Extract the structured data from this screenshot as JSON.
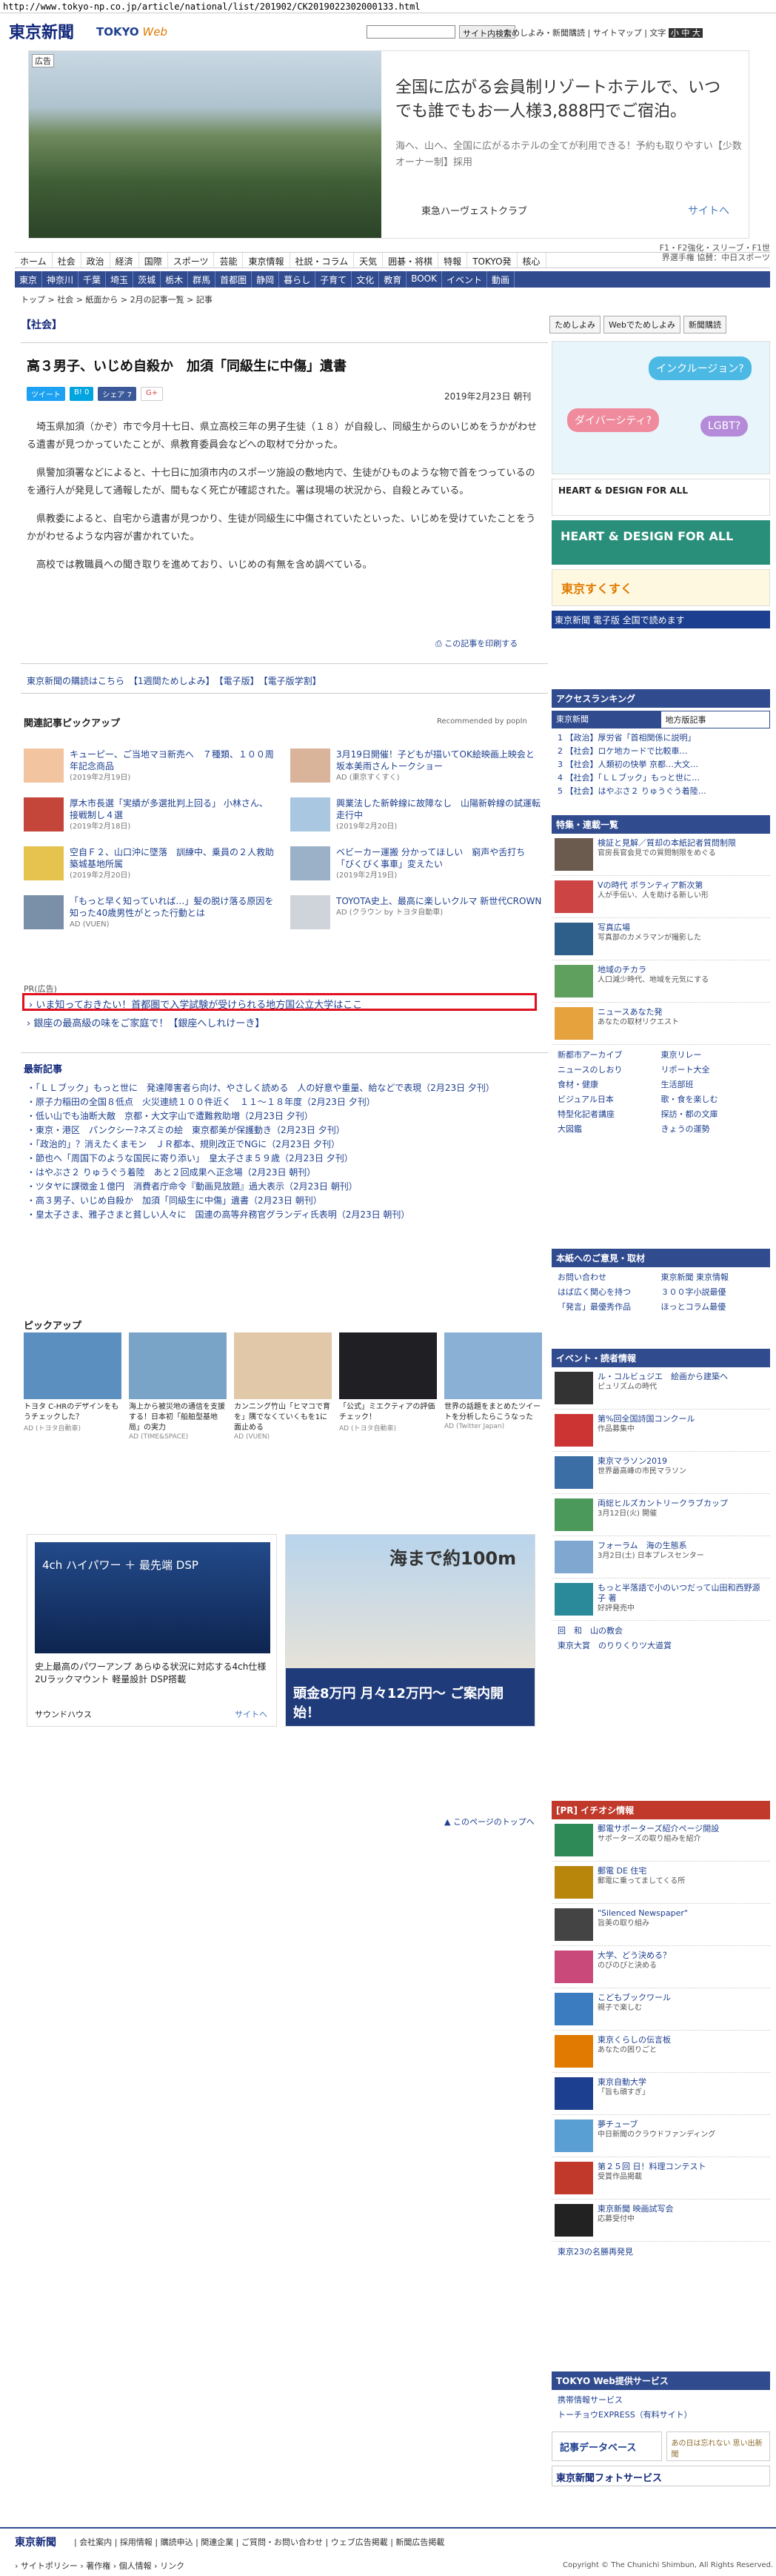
{
  "url": "http://www.tokyo-np.co.jp/article/national/list/201902/CK2019022302000133.html",
  "header": {
    "logo": "東京新聞",
    "web": "TOKYO",
    "web2": "Web",
    "search_button": "サイト内検索",
    "links": "ためしよみ・新聞購読 | サイトマップ | 文字",
    "font_controls": "小 中 大"
  },
  "top_ad": {
    "badge": "広告",
    "headline": "全国に広がる会員制リゾートホテルで、いつでも誰でもお一人様3,888円でご宿泊。",
    "sub": "海へ、山へ、全国に広がるホテルの全てが利用できる！予約も取りやすい【少数オーナー制】採用",
    "brand": "東急ハーヴェストクラブ",
    "next": "サイトへ"
  },
  "sponsor": "F1・F2強化・スリーブ・F1世界選手権\n協賛：中日スポーツ",
  "nav1": [
    "ホーム",
    "社会",
    "政治",
    "経済",
    "国際",
    "スポーツ",
    "芸能",
    "東京情報",
    "社説・コラム",
    "天気",
    "囲碁・将棋",
    "特報",
    "TOKYO発",
    "核心"
  ],
  "nav2": [
    "東京",
    "神奈川",
    "千葉",
    "埼玉",
    "茨城",
    "栃木",
    "群馬",
    "首都圏",
    "静岡",
    "暮らし",
    "子育て",
    "文化",
    "教育",
    "BOOK",
    "イベント",
    "動画"
  ],
  "breadcrumb": "トップ > 社会 > 紙面から > 2月の記事一覧 > 記事",
  "section_label": "【社会】",
  "right_tabs": [
    "ためしよみ",
    "Webでためしよみ",
    "新聞購読"
  ],
  "article": {
    "title": "高３男子、いじめ自殺か　加須「同級生に中傷」遺書",
    "share": [
      "ツイート",
      "B! 0",
      "シェア 7",
      "G+"
    ],
    "date": "2019年2月23日 朝刊",
    "paragraphs": [
      "埼玉県加須（かぞ）市で今月十七日、県立高校三年の男子生徒（１８）が自殺し、同級生からのいじめをうかがわせる遺書が見つかっていたことが、県教育委員会などへの取材で分かった。",
      "県警加須署などによると、十七日に加須市内のスポーツ施設の敷地内で、生徒がひものような物で首をつっているのを通行人が発見して通報したが、間もなく死亡が確認された。署は現場の状況から、自殺とみている。",
      "県教委によると、自宅から遺書が見つかり、生徒が同級生に中傷されていたといった、いじめを受けていたことをうかがわせるような内容が書かれていた。",
      "高校では教職員への聞き取りを進めており、いじめの有無を含め調べている。"
    ],
    "print": "この記事を印刷する",
    "links": "東京新聞の購読はこちら　【1週間ためしよみ】　【電子版】　【電子版学割】"
  },
  "related": {
    "title": "関連記事ピックアップ",
    "rec": "Recommended by popIn",
    "items": [
      {
        "t": "キューピー、ご当地マヨ新売へ　７種類、１００周年記念商品",
        "s": "(2019年2月19日)"
      },
      {
        "t": "3月19日開催！子どもが描いてOK絵映画上映会と坂本美雨さんトークショー",
        "s": "AD (東京すくすく)"
      },
      {
        "t": "厚木市長選「実績が多選批判上回る」 小林さん、接戦制し４選",
        "s": "(2019年2月18日)"
      },
      {
        "t": "興業法した新幹線に故障なし　山陽新幹線の試運転走行中",
        "s": "(2019年2月20日)"
      },
      {
        "t": "空自Ｆ２、山口沖に墜落　訓練中、乗員の２人救助　築城基地所属",
        "s": "(2019年2月20日)"
      },
      {
        "t": "ベビーカー運搬 分かってほしい　窮声や舌打ち「びくびく事車」変えたい",
        "s": "(2019年2月19日)"
      },
      {
        "t": "「もっと早く知っていれば…」髪の脱け落る原因を知った40歳男性がとった行動とは",
        "s": "AD (VUEN)"
      },
      {
        "t": "TOYOTA史上、最高に楽しいクルマ 新世代CROWN",
        "s": "AD (クラウン by トヨタ自動車)"
      }
    ]
  },
  "pr": {
    "label": "PR(広告)",
    "boxed": "いま知っておきたい！首都圏で入学試験が受けられる地方国公立大学はここ",
    "line": "銀座の最高級の味をご家庭で！【銀座へしれけーき】"
  },
  "latest": {
    "title": "最新記事",
    "items": [
      "「ＬＬブック」もっと世に　発達障害者ら向け、やさしく読める　人の好意や重量、給などで表現（2月23日 夕刊）",
      "原子力稲田の全国８低点　火災連続１００件近く　１１～１８年度（2月23日 夕刊）",
      "低い山でも油断大敵　京都・大文字山で遭難救助増（2月23日 夕刊）",
      "東京・港区　パンクシー?ネズミの絵　東京都美が保護動き（2月23日 夕刊）",
      "「政治的」？消えたくまモン　ＪＲ都本、規則改正でNGに（2月23日 夕刊）",
      "節也へ「周国下のような国民に寄り添い」　皇太子さま５９歳（2月23日 夕刊）",
      "はやぶさ２ りゅうぐう着陸　あと２回成果へ正念場（2月23日 朝刊）",
      "ツタヤに課徴金１億円　消費者庁命令『動画見放題』過大表示（2月23日 朝刊）",
      "高３男子、いじめ自殺か　加須「同級生に中傷」遺書（2月23日 朝刊）",
      "皇太子さま、雅子さまと貧しい人々に　国連の高等弁務官グランディ氏表明（2月23日 朝刊）"
    ]
  },
  "pickup": {
    "title": "ピックアップ",
    "items": [
      {
        "t": "トヨタ C-HRのデザインをもうチェックした？",
        "s": "AD (トヨタ自動車)"
      },
      {
        "t": "海上から被災地の通信を支援する！日本初「船舶型基地局」の実力",
        "s": "AD (TIME&SPACE)"
      },
      {
        "t": "カンニング竹山「ヒマコで育を」隅でなくていくもを1に面止める",
        "s": "AD (VUEN)"
      },
      {
        "t": "「公式」ミエクティアの評価チェック！",
        "s": "AD (トヨタ自動車)"
      },
      {
        "t": "世界の話題をまとめたツイートを分析したらこうなった",
        "s": "AD (Twitter Japan)"
      }
    ]
  },
  "ads_bottom": {
    "left_title": "4ch ハイパワー ＋ 最先端 DSP",
    "left_text": "史上最高のパワーアンプ あらゆる状況に対応する4ch仕様 2Uラックマウント 軽量設計 DSP搭載",
    "left_brand": "サウンドハウス",
    "left_next": "サイトへ",
    "right_title": "海まで約100m",
    "right_sub": "頭金8万円 月々12万円〜 ご案内開始！"
  },
  "totop": "このページのトップへ",
  "sidebar": {
    "ranking_title": "アクセスランキング",
    "ranking_tabs": [
      "東京新聞",
      "地方版記事"
    ],
    "ranking": [
      "1 【政治】厚労省「首相関係に説明」",
      "2 【社会】ロケ地カードで比較車…",
      "3 【社会】人類初の快挙 京都…大文…",
      "4 【社会】「ＬＬブック」もっと世に…",
      "5 【社会】はやぶさ２ りゅうぐう着陸…"
    ],
    "special_title": "特集・連載一覧",
    "special": [
      {
        "t": "検証と見解／質却の本紙記者質問制限",
        "s": "官房長官会見での質問制限をめぐる"
      },
      {
        "t": "Vの時代 ボランティア新次第",
        "s": "人が手伝い、人を助ける新しい形"
      },
      {
        "t": "写真広場",
        "s": "写真部のカメラマンが撮影した"
      },
      {
        "t": "地域のチカラ",
        "s": "人口減少時代、地域を元気にする"
      },
      {
        "t": "ニュースあなた発",
        "s": "あなたの取材リクエスト"
      }
    ],
    "sec_links": [
      "新都市アーカイブ",
      "東京リレー",
      "ニュースのしおり",
      "リポート大全",
      "食材・健康",
      "生活部班",
      "ビジュアル日本",
      "歌・食を楽しむ",
      "特型化記者講座",
      "探訪・都の文庫",
      "大図鑑",
      "きょうの運勢"
    ],
    "inquiry_title": "本紙へのご意見・取材",
    "inquiry": [
      "お問い合わせ",
      "東京新聞 東京情報",
      "はば広く関心を持つ",
      "３００字小説最優",
      "「発言」最優秀作品",
      "ほっとコラム最優"
    ],
    "event_title": "イベント・読者情報",
    "events": [
      {
        "t": "ル・コルビュジエ　絵画から建築へ",
        "s": "ピュリズムの時代"
      },
      {
        "t": "第%回全国詩国コンクール",
        "s": "作品募集中"
      },
      {
        "t": "東京マラソン2019",
        "s": "世界最高峰の市民マラソン"
      },
      {
        "t": "両総ヒルズカントリークラブカップ",
        "s": "3月12日(火) 開催"
      },
      {
        "t": "フォーラム　海の生態系",
        "s": "3月2日(土) 日本プレスセンター"
      },
      {
        "t": "もっと半落語で小のいつだって山田和西野源子 著",
        "s": "好評発売中"
      }
    ],
    "event_links": [
      "回　和　山の教会",
      "東京大賞　のりりくりツ大道賞"
    ],
    "pr_title": "[PR] イチオシ情報",
    "pr_items": [
      {
        "t": "郵電サポーターズ紹介ページ開設",
        "s": "サポーターズの取り組みを紹介"
      },
      {
        "t": "郵電 DE 住宅",
        "s": "郵電に乗ってましてくる所"
      },
      {
        "t": "\"Silenced Newspaper\"",
        "s": "旨美の取り組み"
      },
      {
        "t": "大学、どう決める？",
        "s": "のびのびと決める"
      },
      {
        "t": "こどもブックワール",
        "s": "親子で楽しむ"
      },
      {
        "t": "東京くらしの伝言板",
        "s": "あなたの困りごと"
      },
      {
        "t": "東京自動大学",
        "s": "「旨も頑すぎ」"
      },
      {
        "t": "夢チューブ",
        "s": "中日新聞のクラウドファンディング"
      },
      {
        "t": "第２５回 日！料理コンテスト",
        "s": "受賞作品掲載"
      },
      {
        "t": "東京新聞 映画試写会",
        "s": "応募受付中"
      }
    ],
    "pr_more": "東京23の名勝再発見",
    "service_title": "TOKYO Web提供サービス",
    "services": [
      "携帯情報サービス",
      "トーチョウEXPRESS（有料サイト）"
    ],
    "bottom_banner1": "記事データベース",
    "bottom_banner2": "あの日は忘れない 思い出新聞",
    "photo_service": "東京新聞フォトサービス"
  },
  "footer": {
    "logo": "東京新聞",
    "links": "| 会社案内 | 採用情報 | 購読申込 | 関連企業 | ご質問・お問い合わせ | ウェブ広告掲載 | 新聞広告掲載",
    "links2": "› サイトポリシー › 著作権 › 個人情報 › リンク",
    "copyright": "Copyright © The Chunichi Shimbun, All Rights Reserved."
  }
}
